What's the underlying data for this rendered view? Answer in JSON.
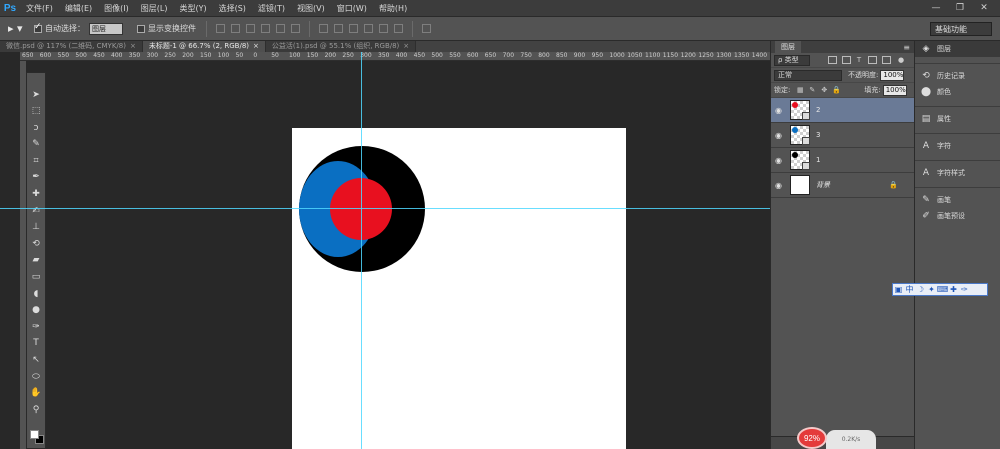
{
  "app": {
    "logo": "Ps",
    "menu": [
      "文件(F)",
      "编辑(E)",
      "图像(I)",
      "图层(L)",
      "类型(Y)",
      "选择(S)",
      "滤镜(T)",
      "视图(V)",
      "窗口(W)",
      "帮助(H)"
    ],
    "window_controls": [
      "—",
      "❐",
      "✕"
    ]
  },
  "options_bar": {
    "auto_select_label": "自动选择：",
    "auto_select_checked": true,
    "auto_select_target": "图层",
    "show_transform_label": "显示变换控件",
    "show_transform_checked": false,
    "workspace": "基础功能"
  },
  "tabs": [
    {
      "label": "微信.psd @ 117% (二维码, CMYK/8)",
      "close": "×",
      "active": false
    },
    {
      "label": "未标题-1 @ 66.7% (2, RGB/8)",
      "close": "×",
      "active": true
    },
    {
      "label": "公益活(1).psd @ 55.1% (组织, RGB/8)",
      "close": "×",
      "active": false
    }
  ],
  "ruler_ticks": [
    "650",
    "600",
    "550",
    "500",
    "450",
    "400",
    "350",
    "300",
    "250",
    "200",
    "150",
    "100",
    "50",
    "0",
    "50",
    "100",
    "150",
    "200",
    "250",
    "300",
    "350",
    "400",
    "450",
    "500",
    "550",
    "600",
    "650",
    "700",
    "750",
    "800",
    "850",
    "900",
    "950",
    "1000",
    "1050",
    "1100",
    "1150",
    "1200",
    "1250",
    "1300",
    "1350",
    "1400"
  ],
  "artwork": {
    "outer_color": "#000000",
    "middle_color": "#0a6fc2",
    "inner_color": "#e8101f"
  },
  "layers_panel": {
    "title": "图层",
    "menu_icon": "≡",
    "filter_kind": "ρ 类型",
    "blend_mode": "正常",
    "opacity_label": "不透明度:",
    "opacity_value": "100%",
    "lock_label": "锁定:",
    "fill_label": "填充:",
    "fill_value": "100%",
    "layers": [
      {
        "name": "2",
        "selected": true,
        "dot_color": "#e8101f"
      },
      {
        "name": "3",
        "selected": false,
        "dot_color": "#0a6fc2"
      },
      {
        "name": "1",
        "selected": false,
        "dot_color": "#000000"
      },
      {
        "name": "背景",
        "selected": false,
        "locked": true
      }
    ]
  },
  "dock": {
    "items": [
      {
        "icon": "◈",
        "label": "图层",
        "active": true
      },
      {
        "icon": "⟲",
        "label": "历史记录"
      },
      {
        "icon": "⬤",
        "label": "颜色"
      },
      {
        "icon": "▤",
        "label": "属性"
      },
      {
        "icon": "A",
        "label": "字符"
      },
      {
        "icon": "A",
        "label": "字符样式"
      },
      {
        "icon": "✎",
        "label": "画笔"
      },
      {
        "icon": "✐",
        "label": "画笔预设"
      }
    ]
  },
  "ime": {
    "items": [
      "中",
      "☽",
      "✦",
      "⌨",
      "✚",
      "✑"
    ]
  },
  "speed_badge": {
    "percent": "92%",
    "side_text": "0.2K/s"
  }
}
